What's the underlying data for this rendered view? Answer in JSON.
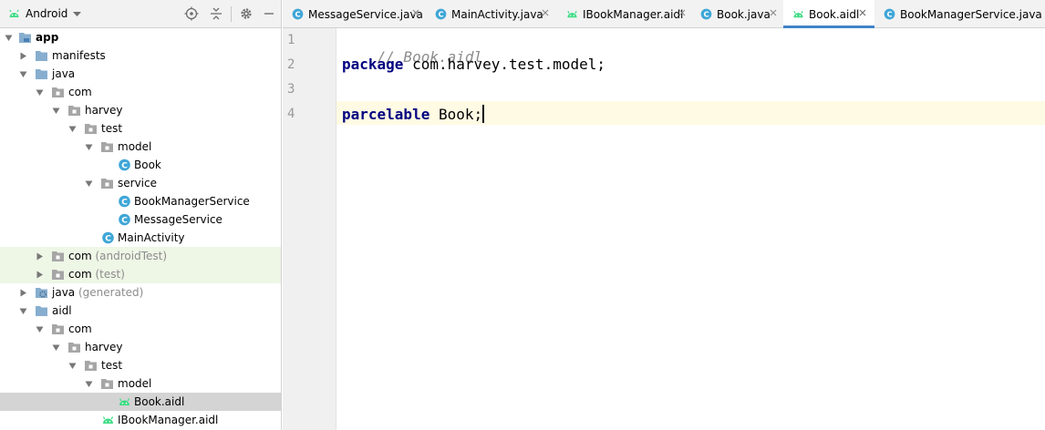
{
  "project_panel": {
    "view_selector": "Android",
    "icons": [
      "android-icon",
      "chevron-down-icon",
      "locate-icon",
      "collapse-all-icon",
      "gear-icon",
      "minimize-icon"
    ]
  },
  "tree": [
    {
      "label": "app",
      "suffix": "",
      "icon": "module-folder-icon",
      "expanded": true
    },
    {
      "label": "manifests",
      "suffix": "",
      "icon": "folder-icon",
      "expanded": false
    },
    {
      "label": "java",
      "suffix": "",
      "icon": "folder-icon",
      "expanded": true
    },
    {
      "label": "com",
      "suffix": "",
      "icon": "package-icon",
      "expanded": true
    },
    {
      "label": "harvey",
      "suffix": "",
      "icon": "package-icon",
      "expanded": true
    },
    {
      "label": "test",
      "suffix": "",
      "icon": "package-icon",
      "expanded": true
    },
    {
      "label": "model",
      "suffix": "",
      "icon": "package-icon",
      "expanded": true
    },
    {
      "label": "Book",
      "suffix": "",
      "icon": "class-icon"
    },
    {
      "label": "service",
      "suffix": "",
      "icon": "package-icon",
      "expanded": true
    },
    {
      "label": "BookManagerService",
      "suffix": "",
      "icon": "class-icon"
    },
    {
      "label": "MessageService",
      "suffix": "",
      "icon": "class-icon"
    },
    {
      "label": "MainActivity",
      "suffix": "",
      "icon": "class-icon"
    },
    {
      "label": "com",
      "suffix": "(androidTest)",
      "icon": "package-icon",
      "expanded": false
    },
    {
      "label": "com",
      "suffix": "(test)",
      "icon": "package-icon",
      "expanded": false
    },
    {
      "label": "java",
      "suffix": "(generated)",
      "icon": "generated-folder-icon",
      "expanded": false
    },
    {
      "label": "aidl",
      "suffix": "",
      "icon": "folder-icon",
      "expanded": true
    },
    {
      "label": "com",
      "suffix": "",
      "icon": "package-icon",
      "expanded": true
    },
    {
      "label": "harvey",
      "suffix": "",
      "icon": "package-icon",
      "expanded": true
    },
    {
      "label": "test",
      "suffix": "",
      "icon": "package-icon",
      "expanded": true
    },
    {
      "label": "model",
      "suffix": "",
      "icon": "package-icon",
      "expanded": true
    },
    {
      "label": "Book.aidl",
      "suffix": "",
      "icon": "aidl-file-icon",
      "selected": true
    },
    {
      "label": "IBookManager.aidl",
      "suffix": "",
      "icon": "aidl-file-icon"
    }
  ],
  "tabs": [
    {
      "label": "MessageService.java",
      "icon": "class-icon",
      "active": false
    },
    {
      "label": "MainActivity.java",
      "icon": "class-icon",
      "active": false
    },
    {
      "label": "IBookManager.aidl",
      "icon": "aidl-file-icon",
      "active": false
    },
    {
      "label": "Book.java",
      "icon": "class-icon",
      "active": false
    },
    {
      "label": "Book.aidl",
      "icon": "aidl-file-icon",
      "active": true
    },
    {
      "label": "BookManagerService.java",
      "icon": "class-icon",
      "active": false
    }
  ],
  "editor": {
    "line_numbers": [
      "1",
      "2",
      "3",
      "4"
    ],
    "lines": [
      {
        "comment": "// Book.aidl"
      },
      {
        "keyword": "package",
        "rest": " com.harvey.test.model;"
      },
      {
        "rest": ""
      },
      {
        "keyword": "parcelable",
        "rest": " Book;"
      }
    ],
    "current_line": 4
  },
  "colors": {
    "class_icon": "#3fa6d7",
    "android_green": "#3ddc84",
    "folder": "#87aecf",
    "package": "#a6a6a6",
    "keyword": "#000080",
    "comment": "#8c8c8c",
    "test_source_bg": "#eef6e6",
    "selected_bg": "#d4d4d4",
    "current_line_bg": "#fffae3",
    "active_tab_underline": "#4083c9"
  }
}
